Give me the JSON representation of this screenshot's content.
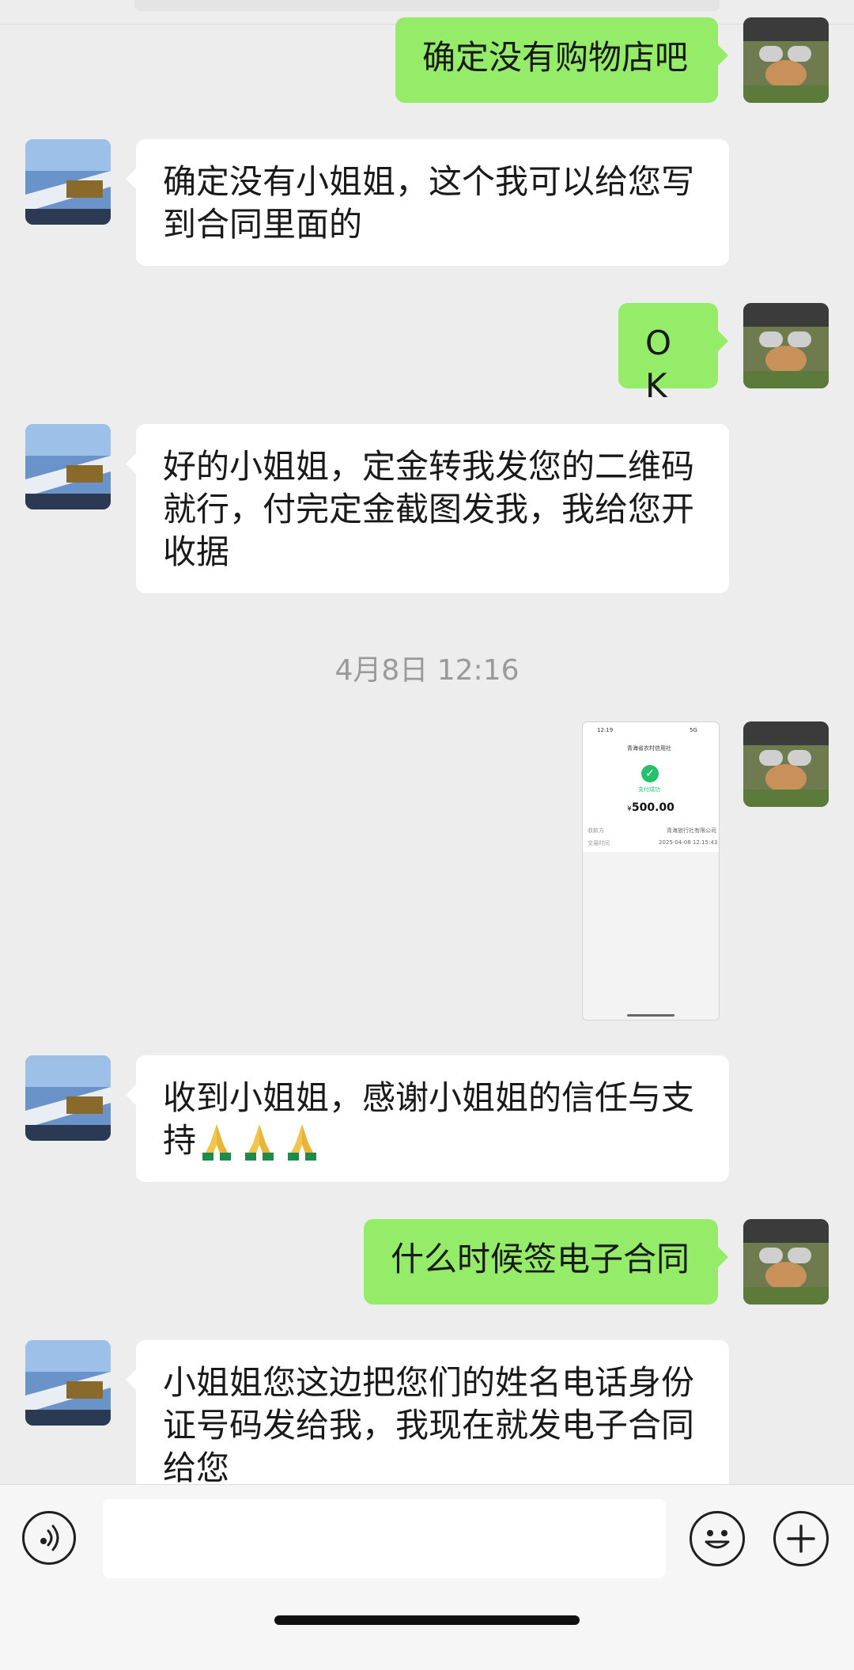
{
  "conversation": {
    "messages": [
      {
        "side": "right",
        "text": "确定没有购物店吧"
      },
      {
        "side": "left",
        "text": "确定没有小姐姐，这个我可以给您写到合同里面的"
      },
      {
        "side": "right",
        "text": "OK"
      },
      {
        "side": "left",
        "text": "好的小姐姐，定金转我发您的二维码就行，付完定金截图发我，我给您开收据"
      },
      {
        "side": "left",
        "text": "收到小姐姐，感谢小姐姐的信任与支持",
        "emoji": [
          "folded-hands",
          "folded-hands",
          "folded-hands"
        ]
      },
      {
        "side": "right",
        "text": "什么时候签电子合同"
      },
      {
        "side": "left",
        "text": "小姐姐您这边把您们的姓名电话身份证号码发给我，我现在就发电子合同给您"
      }
    ],
    "timestamp": "4月8日 12:16",
    "image_message": {
      "status_time": "12:19",
      "status_carrier": "5G",
      "title": "青海省农村信用社",
      "status": "支付成功",
      "amount": "500.00",
      "currency_symbol": "¥",
      "payee_label": "收款方",
      "payee_value": "青海旅行社有限公司",
      "time_label": "交易时间",
      "time_value": "2025-04-08 12:15:43"
    }
  },
  "input_bar": {
    "placeholder": "",
    "icons": [
      "voice-icon",
      "emoji-icon",
      "plus-icon"
    ]
  },
  "colors": {
    "background": "#ededed",
    "outgoing_bubble": "#95ec69",
    "incoming_bubble": "#ffffff",
    "timestamp": "#9a9a9a"
  }
}
